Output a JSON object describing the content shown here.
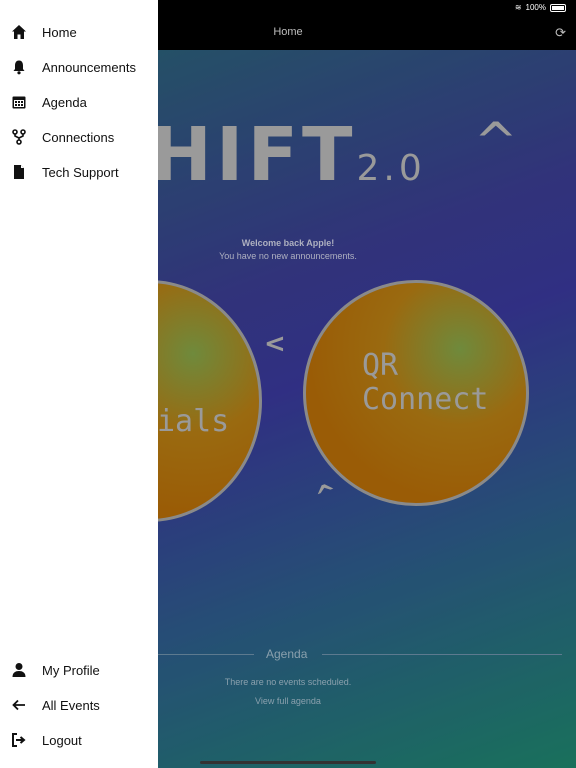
{
  "status_bar": {
    "battery": "100%"
  },
  "nav": {
    "title": "Home"
  },
  "hero": {
    "logo_main": "HIFT",
    "logo_sub": "2.0",
    "logo_caret": "^"
  },
  "welcome": {
    "title": "Welcome back Apple!",
    "subtitle": "You have no new announcements."
  },
  "circles": {
    "left_label": "ials",
    "right_line1": "QR",
    "right_line2": "Connect",
    "arrow_left": "<",
    "arrow_down": "^"
  },
  "agenda": {
    "heading": "Agenda",
    "empty": "There are no events scheduled.",
    "link": "View full agenda"
  },
  "drawer": {
    "top_items": [
      {
        "label": "Home",
        "icon": "home-icon"
      },
      {
        "label": "Announcements",
        "icon": "bell-icon"
      },
      {
        "label": "Agenda",
        "icon": "calendar-icon"
      },
      {
        "label": "Connections",
        "icon": "connections-icon"
      },
      {
        "label": "Tech Support",
        "icon": "document-icon"
      }
    ],
    "bottom_items": [
      {
        "label": "My Profile",
        "icon": "user-icon"
      },
      {
        "label": "All Events",
        "icon": "arrow-left-icon"
      },
      {
        "label": "Logout",
        "icon": "logout-icon"
      }
    ]
  }
}
